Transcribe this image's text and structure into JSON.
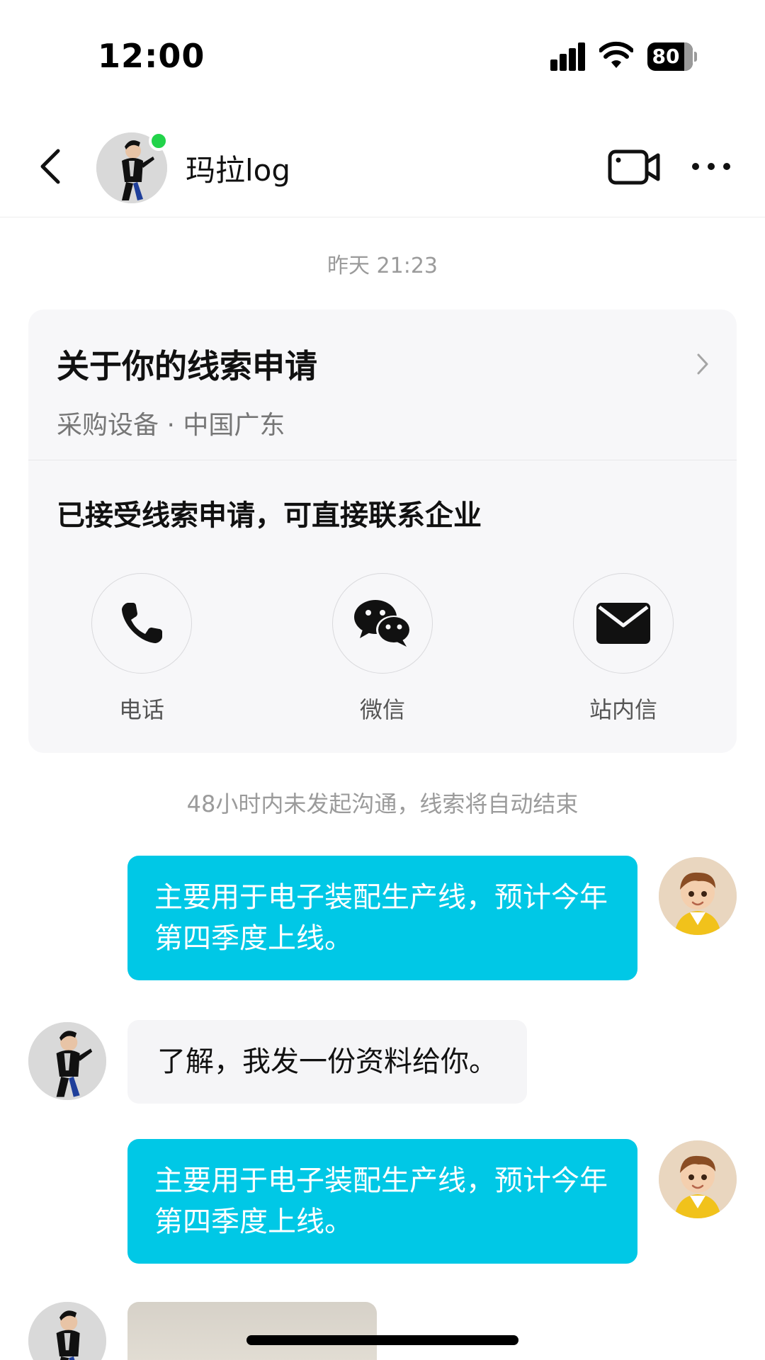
{
  "status_bar": {
    "time": "12:00",
    "battery": "80",
    "icons": [
      "signal-icon",
      "wifi-icon",
      "battery-icon"
    ]
  },
  "header": {
    "contact_name": "玛拉log",
    "online": true,
    "icons": [
      "back-icon",
      "video-call-icon",
      "more-icon"
    ]
  },
  "chat": {
    "timestamp": "昨天 21:23",
    "lead_card": {
      "title": "关于你的线索申请",
      "subtitle": "采购设备 · 中国广东",
      "message": "已接受线索申请，可直接联系企业",
      "actions": [
        {
          "label": "电话",
          "icon": "phone-icon"
        },
        {
          "label": "微信",
          "icon": "wechat-icon"
        },
        {
          "label": "站内信",
          "icon": "mail-icon"
        }
      ]
    },
    "notice": "48小时内未发起沟通，线索将自动结束",
    "messages": [
      {
        "from": "me",
        "text": "主要用于电子装配生产线，预计今年第四季度上线。"
      },
      {
        "from": "other",
        "text": "了解，我发一份资料给你。"
      },
      {
        "from": "me",
        "text": "主要用于电子装配生产线，预计今年第四季度上线。"
      },
      {
        "from": "other",
        "type": "image"
      }
    ]
  },
  "colors": {
    "my_bubble": "#00c8e6",
    "other_bubble": "#f5f5f7",
    "online_dot": "#22d34a",
    "card_bg": "#f7f7f9"
  }
}
